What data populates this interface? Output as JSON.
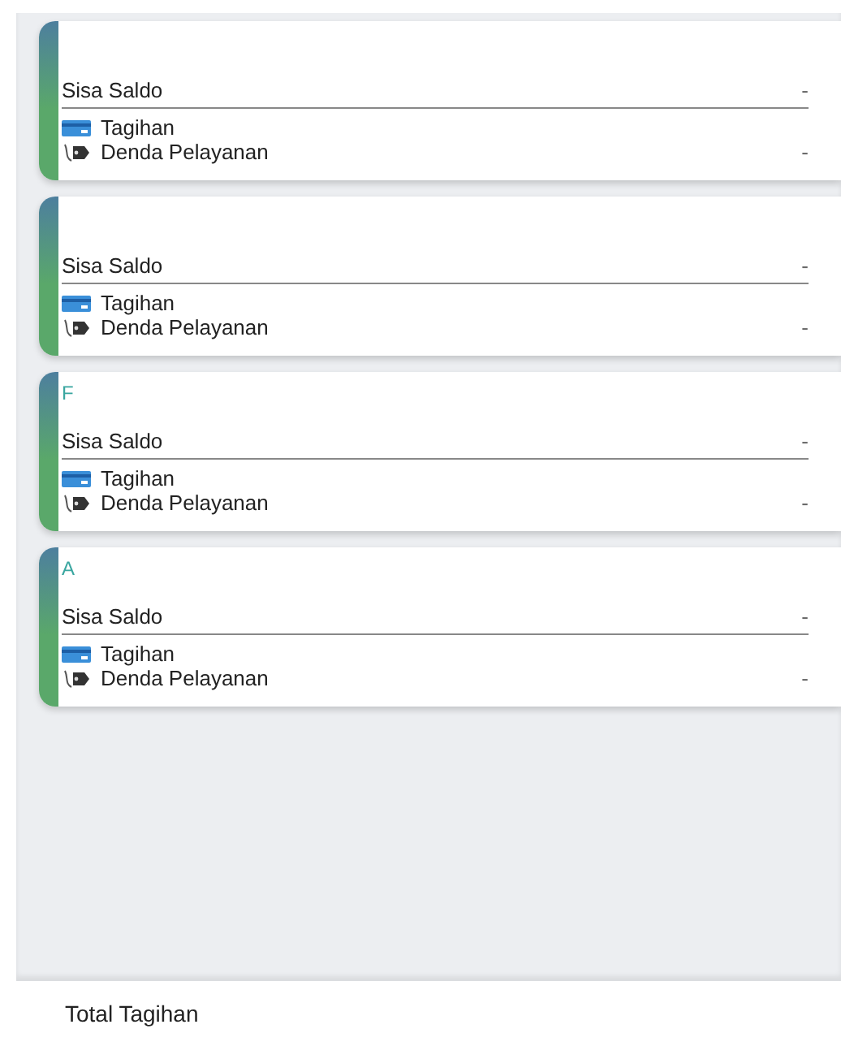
{
  "accounts": [
    {
      "balance_label": "Sisa Saldo",
      "balance_value": "-",
      "bill_label": "Tagihan",
      "fine_label": "Denda Pelayanan",
      "fine_value": "-"
    },
    {
      "balance_label": "Sisa Saldo",
      "balance_value": "-",
      "bill_label": "Tagihan",
      "fine_label": "Denda Pelayanan",
      "fine_value": "-"
    },
    {
      "title": "F",
      "balance_label": "Sisa Saldo",
      "balance_value": "-",
      "bill_label": "Tagihan",
      "fine_label": "Denda Pelayanan",
      "fine_value": "-"
    },
    {
      "title": "A",
      "balance_label": "Sisa Saldo",
      "balance_value": "-",
      "bill_label": "Tagihan",
      "fine_label": "Denda Pelayanan",
      "fine_value": "-"
    }
  ],
  "total": {
    "label": "Total Tagihan"
  }
}
